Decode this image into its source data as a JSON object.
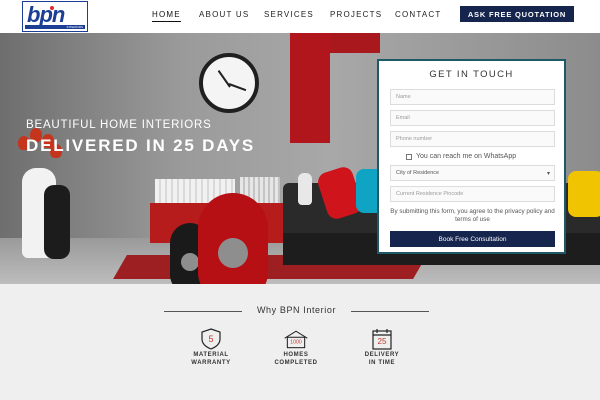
{
  "logo": {
    "text": "bpn",
    "tagline": "INTERIORS"
  },
  "nav": {
    "home": "HOME",
    "about": "ABOUT US",
    "services": "SERVICES",
    "projects": "PROJECTS",
    "contact": "CONTACT"
  },
  "header": {
    "quote_button": "ASK FREE QUOTATION"
  },
  "hero": {
    "subtitle": "BEAUTIFUL HOME INTERIORS",
    "title": "DELIVERED IN 25 DAYS"
  },
  "form": {
    "title": "GET IN TOUCH",
    "name_placeholder": "Name",
    "email_placeholder": "Email",
    "phone_placeholder": "Phone number",
    "whatsapp_label": "You can reach me on WhatsApp",
    "city_select": "City of Residence",
    "pincode_placeholder": "Current Residence Pincode",
    "consent_text": "By submitting this form, you agree to the privacy policy and terms of use",
    "submit_label": "Book Free Consultation"
  },
  "why": {
    "title": "Why BPN Interior",
    "features": [
      {
        "label_line1": "MATERIAL",
        "label_line2": "WARRANTY",
        "icon": "shield-5-icon",
        "badge": "5"
      },
      {
        "label_line1": "HOMES",
        "label_line2": "COMPLETED",
        "icon": "house-1000-icon",
        "badge": "1000"
      },
      {
        "label_line1": "DELIVERY",
        "label_line2": "IN TIME",
        "icon": "calendar-25-icon",
        "badge": "25"
      }
    ]
  },
  "colors": {
    "brand": "#16254d",
    "accent_red": "#b71c1c",
    "logo_blue": "#1c3f95"
  }
}
